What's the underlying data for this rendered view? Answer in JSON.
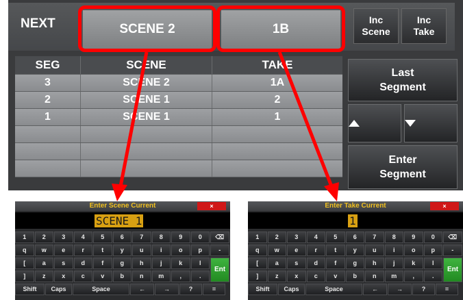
{
  "header": {
    "next_label": "NEXT",
    "scene_value": "SCENE 2",
    "take_value": "1B",
    "inc_scene_line1": "Inc",
    "inc_scene_line2": "Scene",
    "inc_take_line1": "Inc",
    "inc_take_line2": "Take"
  },
  "table": {
    "columns": [
      "SEG",
      "SCENE",
      "TAKE"
    ],
    "rows": [
      [
        "3",
        "SCENE 2",
        "1A"
      ],
      [
        "2",
        "SCENE 1",
        "2"
      ],
      [
        "1",
        "SCENE 1",
        "1"
      ],
      [
        "",
        "",
        ""
      ],
      [
        "",
        "",
        ""
      ],
      [
        "",
        "",
        ""
      ]
    ]
  },
  "side_buttons": {
    "last_line1": "Last",
    "last_line2": "Segment",
    "up_icon": "triangle-up-icon",
    "down_icon": "triangle-down-icon",
    "enter_line1": "Enter",
    "enter_line2": "Segment"
  },
  "highlight_color": "#ff0000",
  "keyboard_scene": {
    "title": "Enter Scene Current",
    "close": "×",
    "value": "SCENE 1"
  },
  "keyboard_take": {
    "title": "Enter Take Current",
    "close": "×",
    "value": "1"
  },
  "keyboard_rows": [
    [
      "1",
      "2",
      "3",
      "4",
      "5",
      "6",
      "7",
      "8",
      "9",
      "0",
      "⌫"
    ],
    [
      "q",
      "w",
      "e",
      "r",
      "t",
      "y",
      "u",
      "i",
      "o",
      "p",
      "-"
    ],
    [
      "[",
      "a",
      "s",
      "d",
      "f",
      "g",
      "h",
      "j",
      "k",
      "l"
    ],
    [
      "]",
      "z",
      "x",
      "c",
      "v",
      "b",
      "n",
      "m",
      ",",
      "."
    ],
    [
      "Shift",
      "Caps",
      "Space",
      "←",
      "→",
      "?",
      "="
    ]
  ],
  "enter_key": "Ent"
}
